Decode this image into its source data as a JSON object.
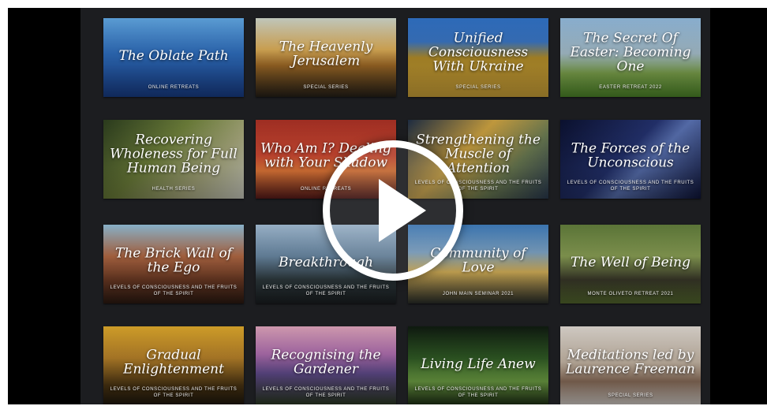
{
  "video": {
    "play_label": "play"
  },
  "tiles": [
    {
      "title": "The Oblate Path",
      "subtitle": "Online Retreats",
      "bg": "linear-gradient(180deg,#5fa4de 0%,#2f6fc0 45%,#183e8a 100%)"
    },
    {
      "title": "The Heavenly Jerusalem",
      "subtitle": "Special Series",
      "bg": "linear-gradient(180deg,#c9d0c4 0%,#e2b25a 40%,#a06a26 60%,#262018 100%)"
    },
    {
      "title": "Unified Consciousness With Ukraine",
      "subtitle": "Special Series",
      "bg": "linear-gradient(180deg,#2f6fc2 0%,#3a76c4 30%,#b58f2a 50%,#d3a73a 100%)"
    },
    {
      "title": "The Secret Of Easter: Becoming One",
      "subtitle": "Easter Retreat 2022",
      "bg": "linear-gradient(180deg,#8fb6d8 0%,#a9c2cf 45%,#7fa64d 70%,#4f8a2a 100%)"
    },
    {
      "title": "Recovering Wholeness for Full Human Being",
      "subtitle": "Health Series",
      "bg": "linear-gradient(135deg,#2c3d1e 0%,#6d7f3a 40%,#a5a67a 70%,#cfd0c4 100%)"
    },
    {
      "title": "Who Am I? Dealing with Your Shadow",
      "subtitle": "Online Retreats",
      "bg": "linear-gradient(180deg,#a73024 0%,#d04a33 45%,#ea7c3a 65%,#5a1b1a 100%)"
    },
    {
      "title": "Strengthening the Muscle of Attention",
      "subtitle": "Levels of Consciousness and the Fruits of the Spirit",
      "bg": "linear-gradient(135deg,#1f2e44 0%,#caa040 40%,#6a7a52 70%,#2a3a50 100%)"
    },
    {
      "title": "The Forces of the Unconscious",
      "subtitle": "Levels of Consciousness and the Fruits of the Spirit",
      "bg": "linear-gradient(135deg,#0b1130 0%,#23316d 45%,#5870b0 60%,#0e1438 100%)"
    },
    {
      "title": "The Brick Wall of the Ego",
      "subtitle": "Levels of Consciousness and the Fruits of the Spirit",
      "bg": "linear-gradient(180deg,#8fbad3 0%,#b46a45 40%,#6e3b24 70%,#2c1a12 100%)"
    },
    {
      "title": "Breakthrough",
      "subtitle": "Levels of Consciousness and the Fruits of the Spirit",
      "bg": "linear-gradient(180deg,#9fb8cf 0%,#6b8aa6 40%,#2f3b3f 70%,#1b1f22 100%)"
    },
    {
      "title": "Community of Love",
      "subtitle": "John Main Seminar 2021",
      "bg": "linear-gradient(180deg,#3e7ab8 0%,#7ea5c7 35%,#d9b45a 60%,#2a2e2a 100%)"
    },
    {
      "title": "The Well of Being",
      "subtitle": "Monte Oliveto Retreat 2021",
      "bg": "linear-gradient(180deg,#5f7a3a 0%,#8aa055 40%,#3b3a2a 70%,#556a2e 100%)"
    },
    {
      "title": "Gradual Enlightenment",
      "subtitle": "Levels of Consciousness and the Fruits of the Spirit",
      "bg": "linear-gradient(180deg,#d8a42a 0%,#b8822a 40%,#4a3412 75%,#1e170c 100%)"
    },
    {
      "title": "Recognising the Gardener",
      "subtitle": "Levels of Consciousness and the Fruits of the Spirit",
      "bg": "linear-gradient(180deg,#d8a0b6 0%,#b06fb0 35%,#5f4a8a 60%,#2b3a22 100%)"
    },
    {
      "title": "Living Life Anew",
      "subtitle": "Levels of Consciousness and the Fruits of the Spirit",
      "bg": "linear-gradient(180deg,#0f1a10 0%,#2f5a24 40%,#6ea044 70%,#1d2e14 100%)"
    },
    {
      "title": "Meditations led by Laurence Freeman",
      "subtitle": "Special Series",
      "bg": "linear-gradient(180deg,#d9d3cc 0%,#c8b9a8 45%,#8b6e5a 70%,#d8d2cc 100%)"
    }
  ]
}
